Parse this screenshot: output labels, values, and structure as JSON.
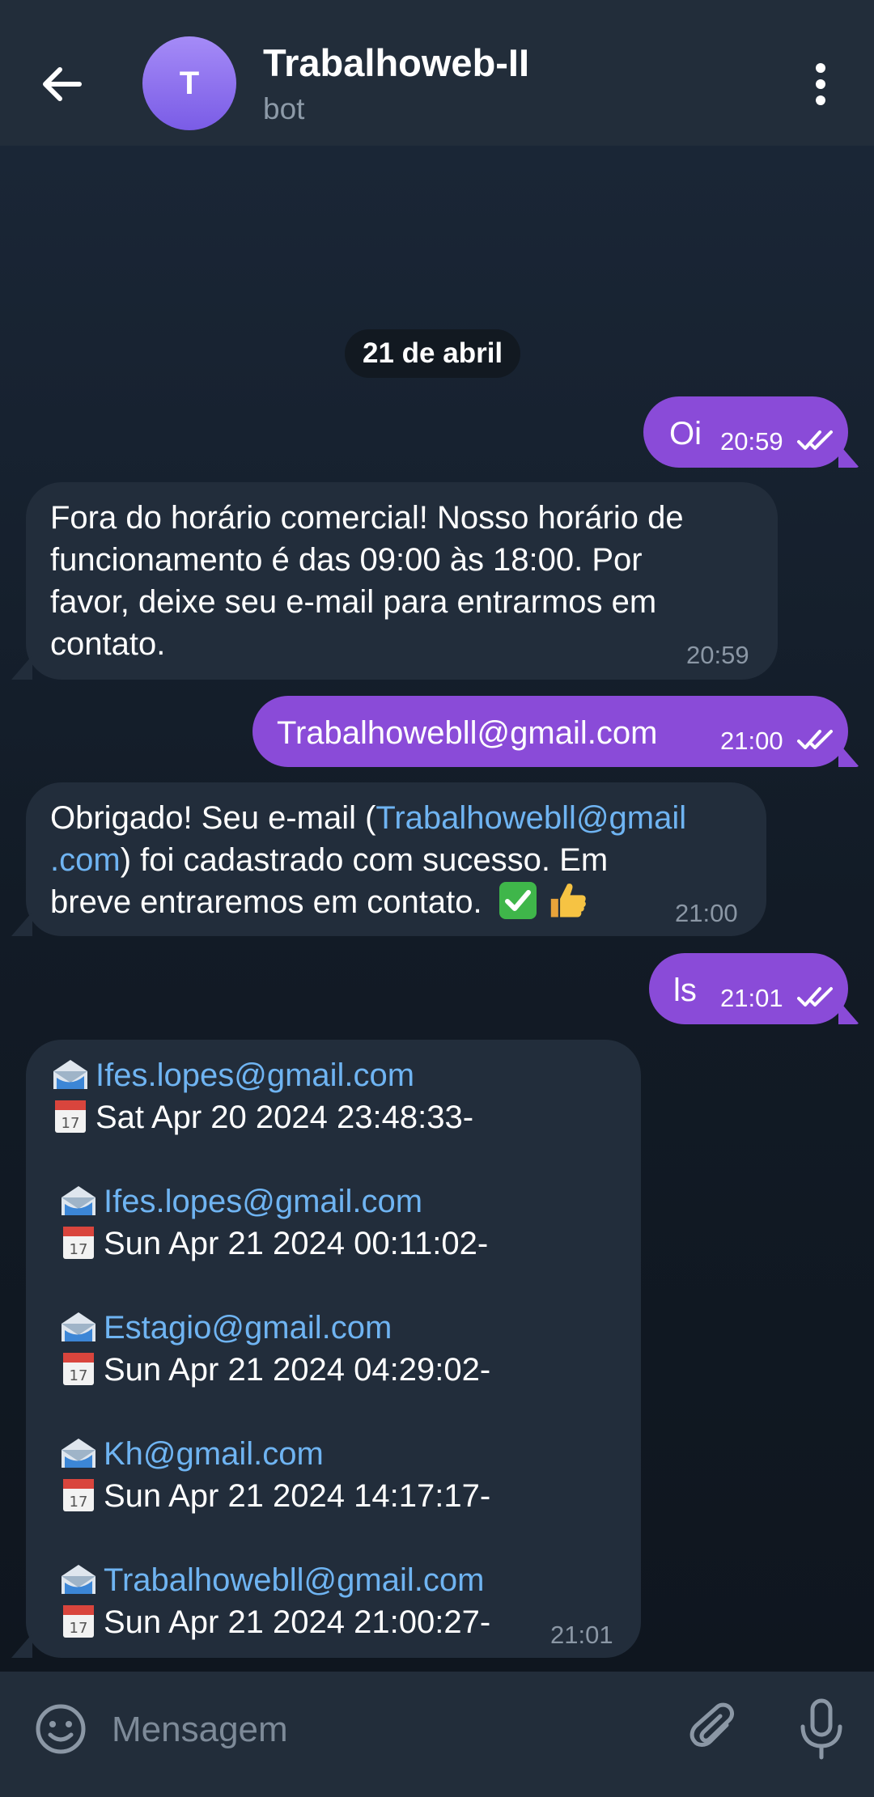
{
  "header": {
    "avatar_letter": "T",
    "title": "Trabalhoweb-II",
    "subtitle": "bot"
  },
  "date_separator": "21 de abril",
  "messages": [
    {
      "dir": "out",
      "text": "Oi",
      "time": "20:59"
    },
    {
      "dir": "in",
      "lines": [
        "Fora do horário comercial! Nosso horário de",
        "funcionamento é das 09:00 às 18:00. Por",
        "favor, deixe seu e-mail para entrarmos em",
        "contato."
      ],
      "time": "20:59"
    },
    {
      "dir": "out",
      "text": "Trabalhowebll@gmail.com",
      "time": "21:00"
    },
    {
      "dir": "in",
      "line1_prefix": "Obrigado! Seu e-mail (",
      "line1_link": "Trabalhowebll@gmail",
      "line2_link": ".com",
      "line2_suffix": ") foi cadastrado com sucesso. Em",
      "line3": "breve entraremos em contato.",
      "time": "21:00"
    },
    {
      "dir": "out",
      "text": "ls",
      "time": "21:01"
    },
    {
      "dir": "in",
      "entries": [
        {
          "email": "Ifes.lopes@gmail.com",
          "date": "Sat Apr 20 2024 23:48:33-"
        },
        {
          "email": "Ifes.lopes@gmail.com",
          "date": "Sun Apr 21 2024 00:11:02-"
        },
        {
          "email": "Estagio@gmail.com",
          "date": "Sun Apr 21 2024 04:29:02-"
        },
        {
          "email": "Kh@gmail.com",
          "date": "Sun Apr 21 2024 14:17:17-"
        },
        {
          "email": "Trabalhowebll@gmail.com",
          "date": "Sun Apr 21 2024 21:00:27-"
        }
      ],
      "time": "21:01"
    }
  ],
  "composer": {
    "placeholder": "Mensagem"
  },
  "icons": {
    "back": "arrow-left-icon",
    "menu": "more-vertical-icon",
    "emoji": "smile-icon",
    "attach": "paperclip-icon",
    "mic": "microphone-icon",
    "read": "double-check-icon",
    "email": "envelope-icon",
    "calendar": "calendar-icon"
  },
  "colors": {
    "accent_bubble": "#8a4bd8",
    "incoming_bubble": "#222d3b",
    "link": "#6fb4f2",
    "avatar": "#8b6cf0"
  }
}
